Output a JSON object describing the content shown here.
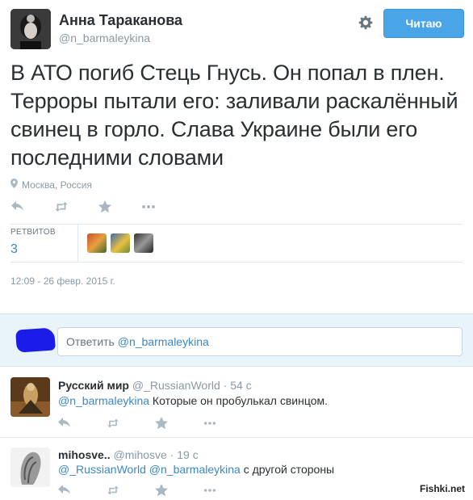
{
  "profile": {
    "name": "Анна Тараканова",
    "handle": "@n_barmaleykina",
    "follow_label": "Читаю"
  },
  "tweet": {
    "text": "В АТО погиб Стець Гнусь. Он попал в плен. Терроры пытали его: заливали раскалённый свинец в горло. Слава Украине были его последними словами",
    "location": "Москва, Россия",
    "retweets_label": "РЕТВИТОВ",
    "retweets_count": "3",
    "timestamp": "12:09 - 26 февр. 2015 г."
  },
  "reply_box": {
    "prefix": "Ответить ",
    "mention": "@n_barmaleykina"
  },
  "replies": [
    {
      "name": "Русский мир",
      "handle": "@_RussianWorld",
      "time": "· 54 с",
      "mention": "@n_barmaleykina",
      "text": " Которые он пробулькал свинцом."
    },
    {
      "name": "mihosve..",
      "handle": "@mihosve",
      "time": "· 19 с",
      "mention1": "@_RussianWorld",
      "mention2": "@n_barmaleykina",
      "text": " с другой стороны"
    }
  ],
  "watermark": "Fishki.net",
  "colors": {
    "accent": "#4aa4e8",
    "link": "#3b88c3",
    "muted": "#8899a6",
    "reply_bg": "#e8f3fa"
  }
}
